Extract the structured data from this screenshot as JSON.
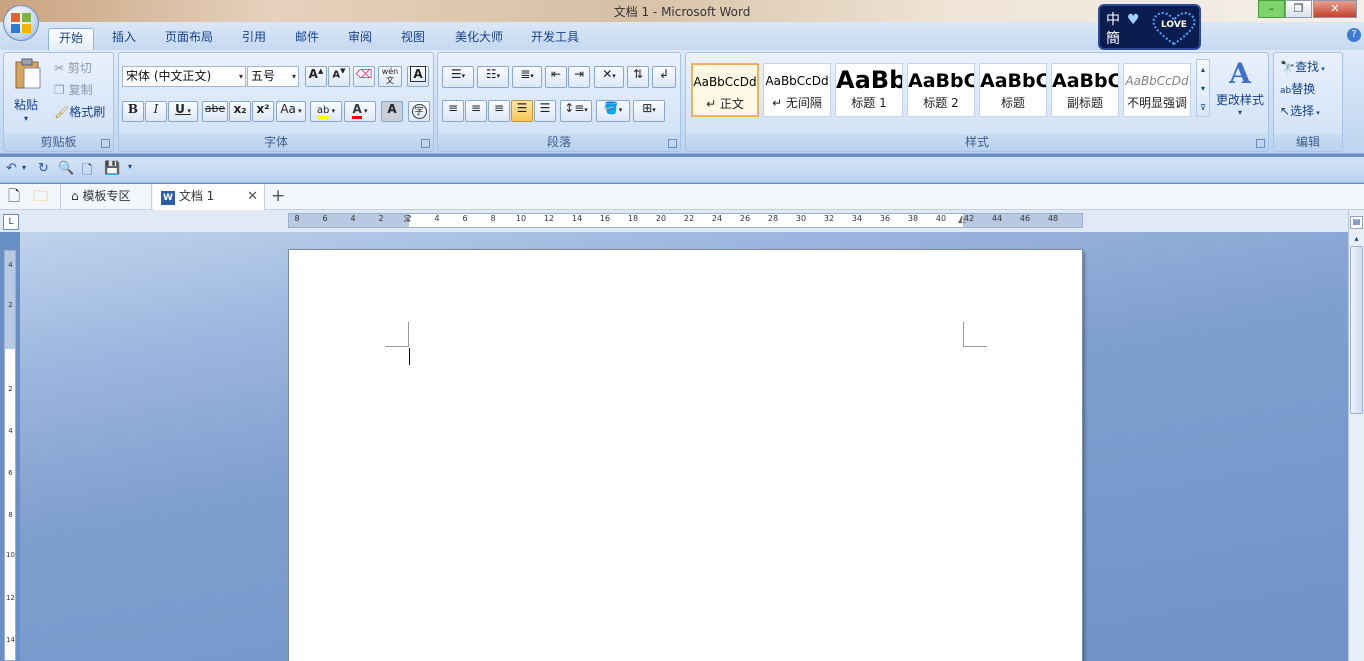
{
  "window": {
    "title": "文档 1 - Microsoft Word",
    "controls": [
      "–",
      "❐",
      "✕"
    ]
  },
  "ime": {
    "line1": "中",
    "line2": "簡",
    "badge": "LOVE"
  },
  "ribbon_tabs": [
    "开始",
    "插入",
    "页面布局",
    "引用",
    "邮件",
    "审阅",
    "视图",
    "美化大师",
    "开发工具"
  ],
  "clipboard": {
    "paste": "粘贴",
    "cut": "剪切",
    "copy": "复制",
    "format_painter": "格式刷",
    "label": "剪贴板"
  },
  "font": {
    "name": "宋体 (中文正文)",
    "size": "五号",
    "label": "字体",
    "bold": "B",
    "italic": "I",
    "underline": "U",
    "strike": "abe",
    "sub": "x₂",
    "sup": "x²",
    "case": "Aa",
    "grow": "A",
    "shrink": "A",
    "phonetic": "文",
    "char_border": "A",
    "char_shade": "A",
    "enclose": "字",
    "wen": "wén"
  },
  "paragraph": {
    "label": "段落"
  },
  "styles": {
    "label": "样式",
    "items": [
      {
        "sample": "AaBbCcDd",
        "name": "↵ 正文"
      },
      {
        "sample": "AaBbCcDd",
        "name": "↵ 无间隔"
      },
      {
        "sample": "AaBb",
        "name": "标题 1"
      },
      {
        "sample": "AaBbC",
        "name": "标题 2"
      },
      {
        "sample": "AaBbC",
        "name": "标题"
      },
      {
        "sample": "AaBbC",
        "name": "副标题"
      },
      {
        "sample": "AaBbCcDd",
        "name": "不明显强调"
      }
    ],
    "change": "更改样式"
  },
  "editing": {
    "label": "编辑",
    "find": "查找",
    "replace": "替换",
    "select": "选择"
  },
  "doc_tabs": {
    "templates": "模板专区",
    "doc": "文档 1",
    "add": "+"
  },
  "ruler": {
    "h_ticks": [
      "8",
      "6",
      "4",
      "2",
      "2",
      "4",
      "6",
      "8",
      "10",
      "12",
      "14",
      "16",
      "18",
      "20",
      "22",
      "24",
      "26",
      "28",
      "30",
      "32",
      "34",
      "36",
      "38",
      "40",
      "42",
      "44",
      "46",
      "48"
    ],
    "v_ticks": [
      "4",
      "2",
      "2",
      "4",
      "6",
      "8",
      "10",
      "12",
      "14"
    ]
  },
  "colors": {
    "accent": "#15428b",
    "highlight": "#ffff00",
    "font_color": "#ff0000"
  }
}
